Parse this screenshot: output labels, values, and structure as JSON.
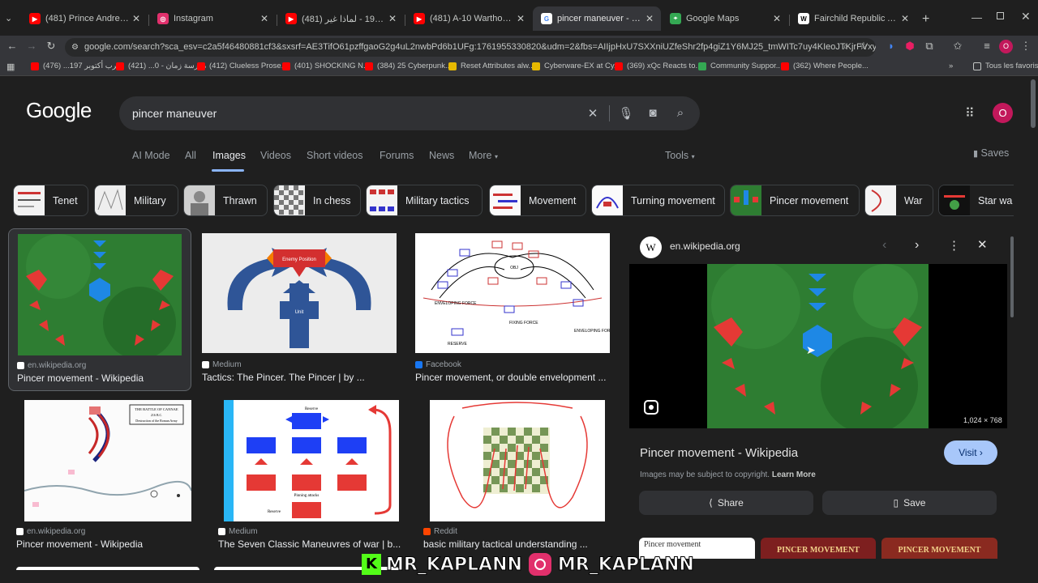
{
  "tabs": [
    {
      "title": "(481) Prince Andrew & the Epst",
      "favicon": "youtube-icon",
      "color": "#ff0000"
    },
    {
      "title": "Instagram",
      "favicon": "instagram-icon",
      "color": "#e1306c"
    },
    {
      "title": "(481) حرب أكتوبر 1973 - لماذا غير",
      "favicon": "youtube-icon",
      "color": "#ff0000"
    },
    {
      "title": "(481) A-10 Warthog (Thunderb",
      "favicon": "youtube-icon",
      "color": "#ff0000"
    },
    {
      "title": "pincer maneuver - Google Sear",
      "favicon": "google-icon",
      "color": "#4285f4",
      "active": true
    },
    {
      "title": "Google Maps",
      "favicon": "maps-icon",
      "color": "#34a853"
    },
    {
      "title": "Fairchild Republic A-10 Thunde",
      "favicon": "wikipedia-icon",
      "color": "#ffffff"
    }
  ],
  "url": "google.com/search?sca_esv=c2a5f46480881cf3&sxsrf=AE3TifO61pzffgaoG2g4uL2nwbPd6b1UFg:1761955330820&udm=2&fbs=AIIjpHxU7SXXniUZfeShr2fp4giZ1Y6MJ25_tmWITc7uy4KIeoJTKjrFVxydQWqI2NcOha3O1Yq667...",
  "bookmarks": [
    {
      "label": "حرب أكتوبر 197... (476)",
      "color": "#ff0000"
    },
    {
      "label": "مدرسة زمان - 0... (421)",
      "color": "#ff0000"
    },
    {
      "label": "(412) Clueless Prose...",
      "color": "#ff0000"
    },
    {
      "label": "(401) SHOCKING N...",
      "color": "#ff0000"
    },
    {
      "label": "(384) 25 Cyberpunk...",
      "color": "#ff0000"
    },
    {
      "label": "Reset Attributes alw...",
      "color": "#e6b800"
    },
    {
      "label": "Cyberware-EX at Cy...",
      "color": "#e6b800"
    },
    {
      "label": "(369) xQc Reacts to...",
      "color": "#ff0000"
    },
    {
      "label": "Community Suppor...",
      "color": "#34a853"
    },
    {
      "label": "(362) Where People...",
      "color": "#ff0000"
    }
  ],
  "bookmarks_all": "Tous les favoris",
  "search": {
    "query": "pincer maneuver"
  },
  "logo": "Google",
  "avatar_letter": "O",
  "nav": {
    "items": [
      "AI Mode",
      "All",
      "Images",
      "Videos",
      "Short videos",
      "Forums",
      "News",
      "More"
    ],
    "tools": "Tools",
    "saves": "Saves"
  },
  "chips": [
    "Tenet",
    "Military",
    "Thrawn",
    "In chess",
    "Military tactics",
    "Movement",
    "Turning movement",
    "Pincer movement",
    "War",
    "Star wa"
  ],
  "results": [
    {
      "source": "en.wikipedia.org",
      "title": "Pincer movement - Wikipedia",
      "favcolor": "#ffffff"
    },
    {
      "source": "Medium",
      "title": "Tactics: The Pincer. The Pincer | by ...",
      "favcolor": "#ffffff"
    },
    {
      "source": "Facebook",
      "title": "Pincer movement, or double envelopment ...",
      "favcolor": "#1877f2"
    },
    {
      "source": "en.wikipedia.org",
      "title": "Pincer movement - Wikipedia",
      "favcolor": "#ffffff"
    },
    {
      "source": "Medium",
      "title": "The Seven Classic Maneuvres of war | b...",
      "favcolor": "#ffffff"
    },
    {
      "source": "Reddit",
      "title": "basic military tactical understanding ...",
      "favcolor": "#ff4500"
    }
  ],
  "thumb_texts": {
    "enemy_position": "Enemy Position",
    "unit": "Unit",
    "enveloping_force": "ENVELOPING FORCE",
    "fixing_force": "FIXING FORCE",
    "reserve": "RESERVE",
    "obj": "OBJ",
    "cannae_title": "THE BATTLE OF CANNAE",
    "cannae_date": "216 B.C.",
    "cannae_sub": "Destruction of the Roman Army",
    "reserve2": "Reserve",
    "pinning": "Pinning attacks"
  },
  "panel": {
    "source": "en.wikipedia.org",
    "dimensions": "1,024 × 768",
    "title": "Pincer movement - Wikipedia",
    "visit": "Visit",
    "copyright": "Images may be subject to copyright.",
    "learn_more": "Learn More",
    "share": "Share",
    "save": "Save",
    "related": [
      "Pincer movement",
      "PINCER MOVEMENT",
      "PINCER MOVEMENT"
    ]
  },
  "watermark": {
    "left": "MR_KAPLANN",
    "right": "MR_KAPLANN"
  }
}
